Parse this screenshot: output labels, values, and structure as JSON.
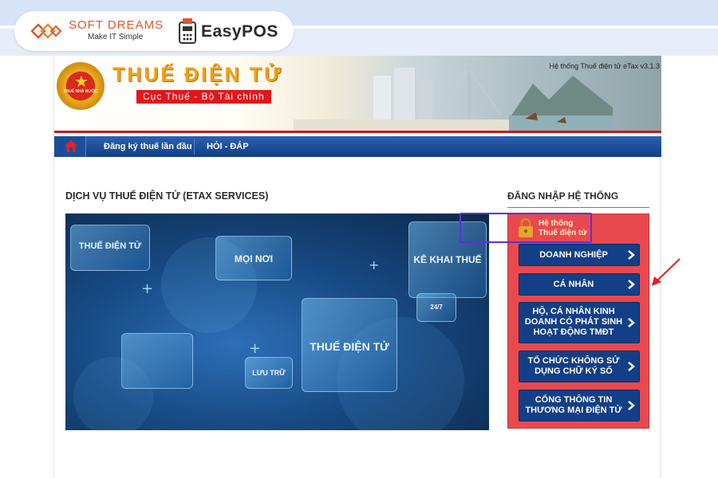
{
  "brand": {
    "softdreams_name": "SOFT DREAMS",
    "softdreams_tagline": "Make IT Simple",
    "easypos_name": "EasyPOS"
  },
  "header": {
    "emblem_text": "THUẾ NHÀ NƯỚC",
    "title": "THUẾ ĐIỆN TỬ",
    "subtitle": "Cục Thuế - Bộ Tài chính",
    "system_version": "Hệ thống Thuế điện tử eTax v3.1.3"
  },
  "nav": {
    "items": [
      {
        "label": "Đăng ký thuế lần đầu"
      },
      {
        "label": "HỎI - ĐÁP"
      }
    ]
  },
  "main": {
    "services_title": "DỊCH VỤ THUẾ ĐIỆN TỬ (ETAX SERVICES)",
    "hero_tiles": [
      "THUẾ ĐIỆN TỬ",
      "MỌI NƠI",
      "KÊ KHAI THUẾ",
      "THUẾ ĐIỆN TỬ",
      "LƯU TRỮ",
      "24/7"
    ]
  },
  "login": {
    "title": "ĐĂNG NHẬP HỆ THỐNG",
    "system_label_line1": "Hệ thống",
    "system_label_line2": "Thuế điện tử",
    "buttons": [
      {
        "label": "DOANH NGHIỆP"
      },
      {
        "label": "CÁ NHÂN"
      },
      {
        "label": "HỘ, CÁ NHÂN KINH DOANH CÓ PHÁT SINH HOẠT ĐỘNG TMĐT"
      },
      {
        "label": "TỔ CHỨC KHÔNG SỬ DỤNG CHỮ KÝ SỐ"
      },
      {
        "label": "CỔNG THÔNG TIN THƯƠNG MẠI ĐIỆN TỬ"
      }
    ]
  },
  "colors": {
    "nav_blue": "#123f86",
    "login_red": "#e8494e",
    "highlight": "#5a33d6",
    "arrow": "#e02020"
  }
}
